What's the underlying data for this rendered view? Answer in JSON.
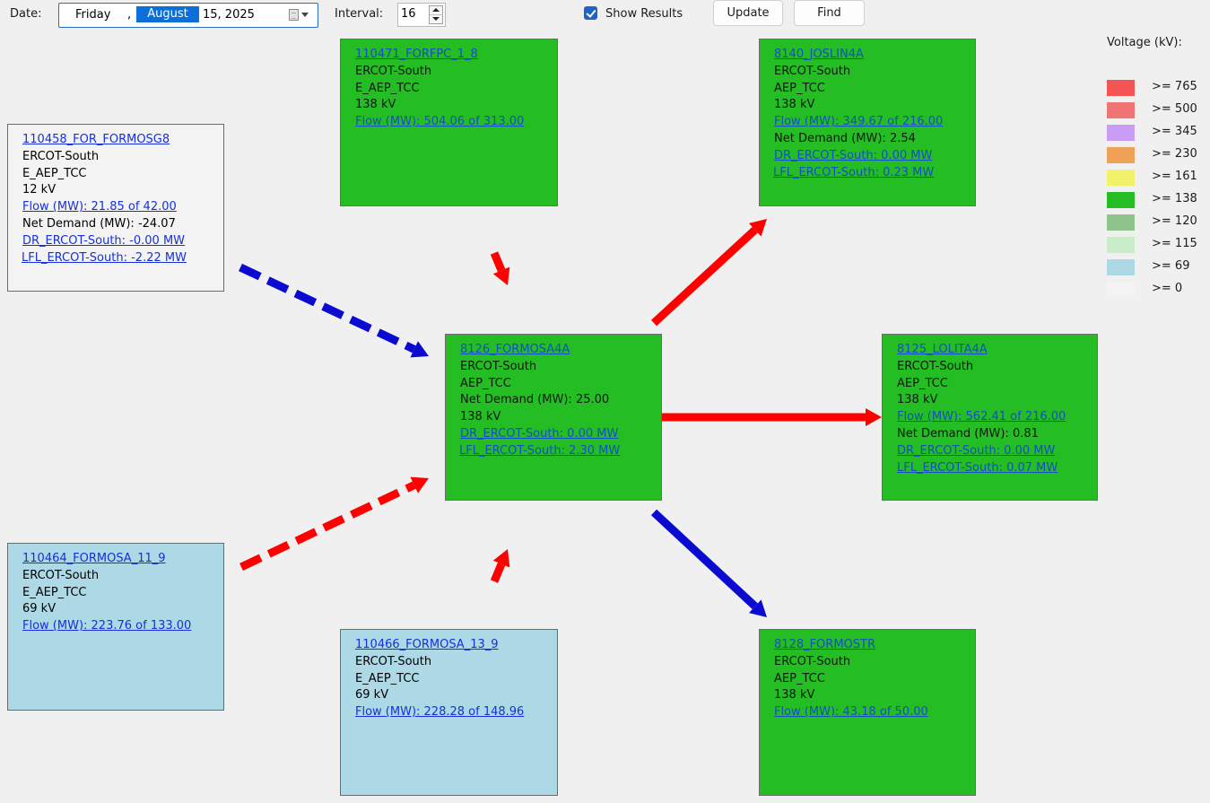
{
  "toolbar": {
    "date_label": "Date:",
    "date": {
      "weekday": "Friday",
      "separator": ",",
      "month": "August",
      "rest": "15, 2025"
    },
    "interval_label": "Interval:",
    "interval_value": "16",
    "show_results_label": "Show Results",
    "show_results_checked": true,
    "update_label": "Update",
    "find_label": "Find"
  },
  "legend": {
    "title": "Voltage (kV):",
    "items": [
      {
        "label": ">= 765",
        "color": "#f45454"
      },
      {
        "label": ">= 500",
        "color": "#ef7575"
      },
      {
        "label": ">= 345",
        "color": "#c99cf6"
      },
      {
        "label": ">= 230",
        "color": "#efa257"
      },
      {
        "label": ">= 161",
        "color": "#f2f26a"
      },
      {
        "label": ">= 138",
        "color": "#24bd24"
      },
      {
        "label": ">= 120",
        "color": "#8dc58d"
      },
      {
        "label": ">= 115",
        "color": "#c9ecc9"
      },
      {
        "label": ">= 69",
        "color": "#add8e6"
      },
      {
        "label": ">= 0",
        "color": "#f3f3f3"
      }
    ]
  },
  "nodes": {
    "forfpc": {
      "name": "110471_FORFPC_1_8",
      "zone": "ERCOT-South",
      "owner": "E_AEP_TCC",
      "voltage": "138 kV",
      "flow": "Flow (MW): 504.06 of 313.00"
    },
    "formosg8": {
      "name": "110458_FOR_FORMOSG8",
      "zone": "ERCOT-South",
      "owner": "E_AEP_TCC",
      "voltage": "12 kV",
      "flow": "Flow (MW): 21.85 of 42.00",
      "net_demand": "Net Demand (MW): -24.07",
      "dr": "DR_ERCOT-South: -0.00 MW",
      "lfl": "LFL_ERCOT-South: -2.22 MW"
    },
    "joslin": {
      "name": "8140_JOSLIN4A",
      "zone": "ERCOT-South",
      "owner": "AEP_TCC",
      "voltage": "138 kV",
      "flow": "Flow (MW): 349.67 of 216.00",
      "net_demand": "Net Demand (MW): 2.54",
      "dr": "DR_ERCOT-South: 0.00 MW",
      "lfl": "LFL_ERCOT-South: 0.23 MW"
    },
    "center": {
      "name": "8126_FORMOSA4A",
      "zone": "ERCOT-South",
      "owner": "AEP_TCC",
      "net_demand": "Net Demand (MW): 25.00",
      "voltage": "138 kV",
      "dr": "DR_ERCOT-South: 0.00 MW",
      "lfl": "LFL_ERCOT-South: 2.30 MW"
    },
    "lolita": {
      "name": "8125_LOLITA4A",
      "zone": "ERCOT-South",
      "owner": "AEP_TCC",
      "voltage": "138 kV",
      "flow": "Flow (MW): 562.41 of 216.00",
      "net_demand": "Net Demand (MW): 0.81",
      "dr": "DR_ERCOT-South: 0.00 MW",
      "lfl": "LFL_ERCOT-South: 0.07 MW"
    },
    "formosa11": {
      "name": "110464_FORMOSA_11_9",
      "zone": "ERCOT-South",
      "owner": "E_AEP_TCC",
      "voltage": "69 kV",
      "flow": "Flow (MW): 223.76 of 133.00"
    },
    "formosa13": {
      "name": "110466_FORMOSA_13_9",
      "zone": "ERCOT-South",
      "owner": "E_AEP_TCC",
      "voltage": "69 kV",
      "flow": "Flow (MW): 228.28 of 148.96"
    },
    "formostr": {
      "name": "8128_FORMOSTR",
      "zone": "ERCOT-South",
      "owner": "AEP_TCC",
      "voltage": "138 kV",
      "flow": "Flow (MW): 43.18 of 50.00"
    }
  },
  "flows": [
    {
      "from": "formosg8",
      "to": "center",
      "color": "#0a0ad0",
      "style": "dashed"
    },
    {
      "from": "forfpc",
      "to": "center",
      "color": "#ff0000",
      "style": "solid"
    },
    {
      "from": "formosa11",
      "to": "center",
      "color": "#ff0000",
      "style": "dashed"
    },
    {
      "from": "formosa13",
      "to": "center",
      "color": "#ff0000",
      "style": "solid"
    },
    {
      "from": "center",
      "to": "joslin",
      "color": "#ff0000",
      "style": "solid"
    },
    {
      "from": "center",
      "to": "lolita",
      "color": "#ff0000",
      "style": "solid"
    },
    {
      "from": "center",
      "to": "formostr",
      "color": "#0a0ad0",
      "style": "solid"
    }
  ]
}
